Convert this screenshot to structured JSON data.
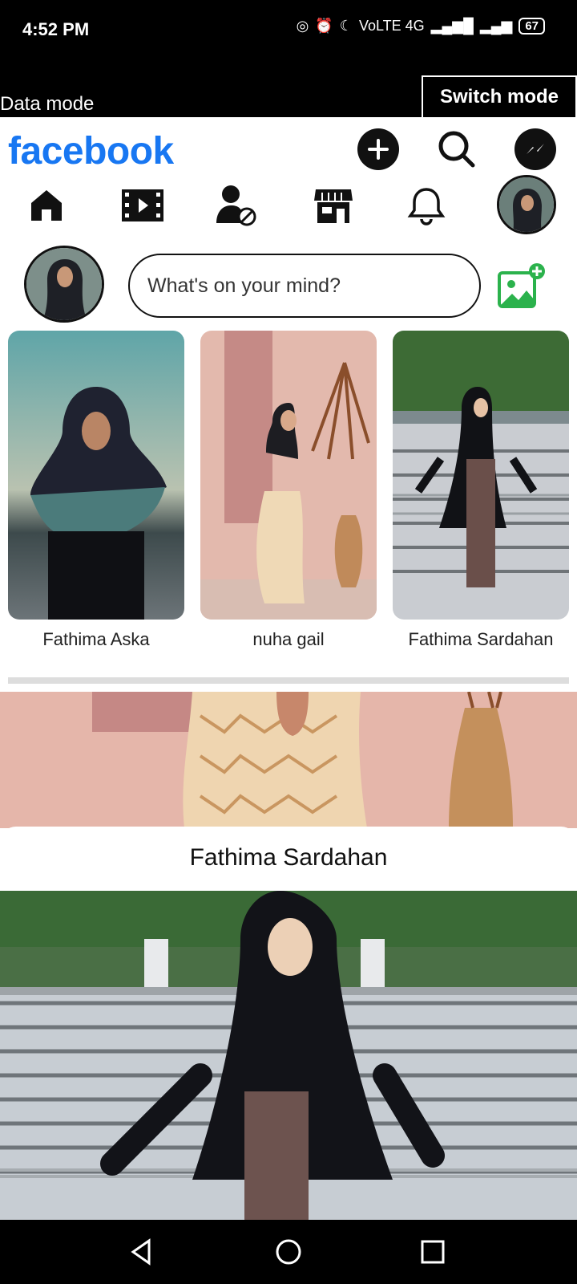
{
  "status_bar": {
    "time": "4:52 PM",
    "network": "VoLTE 4G",
    "battery": "67"
  },
  "data_bar": {
    "label": "Data mode",
    "switch_label": "Switch mode"
  },
  "header": {
    "logo": "facebook"
  },
  "composer": {
    "placeholder": "What's on your mind?"
  },
  "stories": [
    {
      "name": "Fathima Aska"
    },
    {
      "name": "nuha gail"
    },
    {
      "name": "Fathima Sardahan"
    }
  ],
  "post": {
    "author": "Fathima Sardahan"
  },
  "colors": {
    "brand": "#1877f2",
    "photo_green": "#2bb24c"
  }
}
